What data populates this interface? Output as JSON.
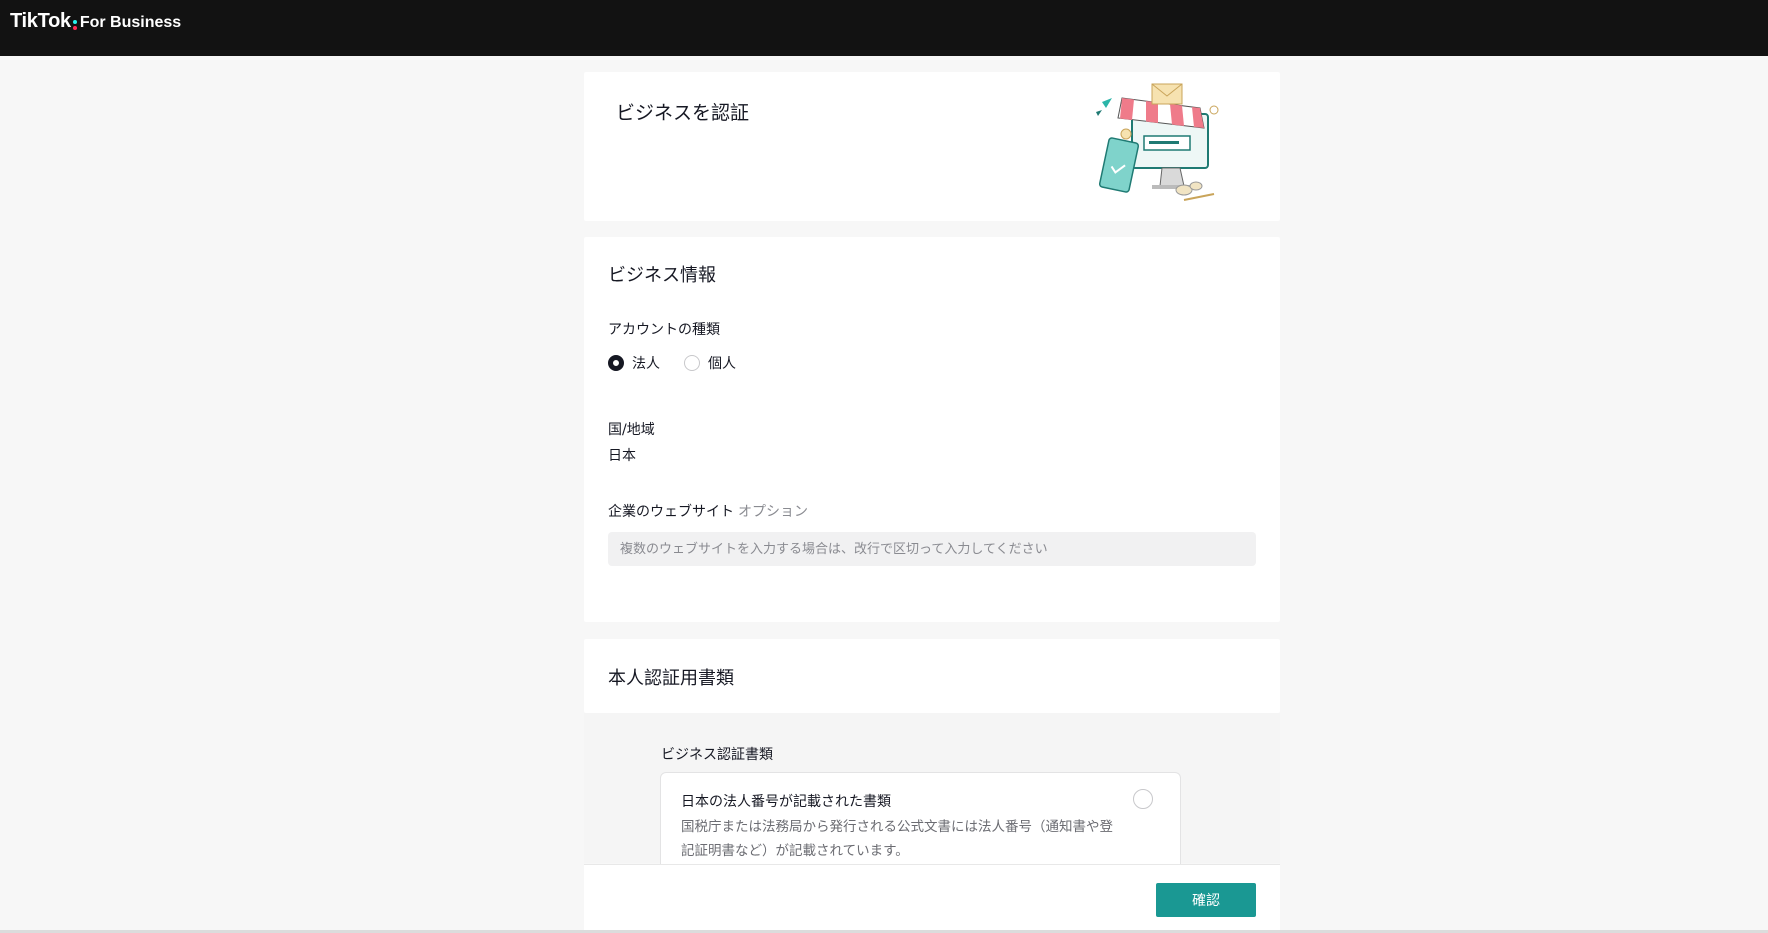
{
  "header": {
    "brand": "TikTok",
    "product": "For Business"
  },
  "verify_card": {
    "title": "ビジネスを認証",
    "illustration": "storefront-illustration"
  },
  "business_info": {
    "title": "ビジネス情報",
    "account_type_label": "アカウントの種類",
    "account_types": [
      {
        "label": "法人",
        "checked": true
      },
      {
        "label": "個人",
        "checked": false
      }
    ],
    "country_label": "国/地域",
    "country_value": "日本",
    "website_label": "企業のウェブサイト",
    "website_optional": "オプション",
    "website_placeholder": "複数のウェブサイトを入力する場合は、改行で区切って入力してください",
    "website_value": ""
  },
  "id_docs": {
    "title": "本人認証用書類",
    "doc_heading": "ビジネス認証書類",
    "option": {
      "title": "日本の法人番号が記載された書類",
      "description": "国税庁または法務局から発行される公式文書には法人番号（通知書や登記証明書など）が記載されています。",
      "selected": false
    }
  },
  "footer": {
    "confirm_label": "確認"
  },
  "colors": {
    "topbar": "#121212",
    "accent": "#1a9893",
    "background": "#f7f7f7"
  }
}
